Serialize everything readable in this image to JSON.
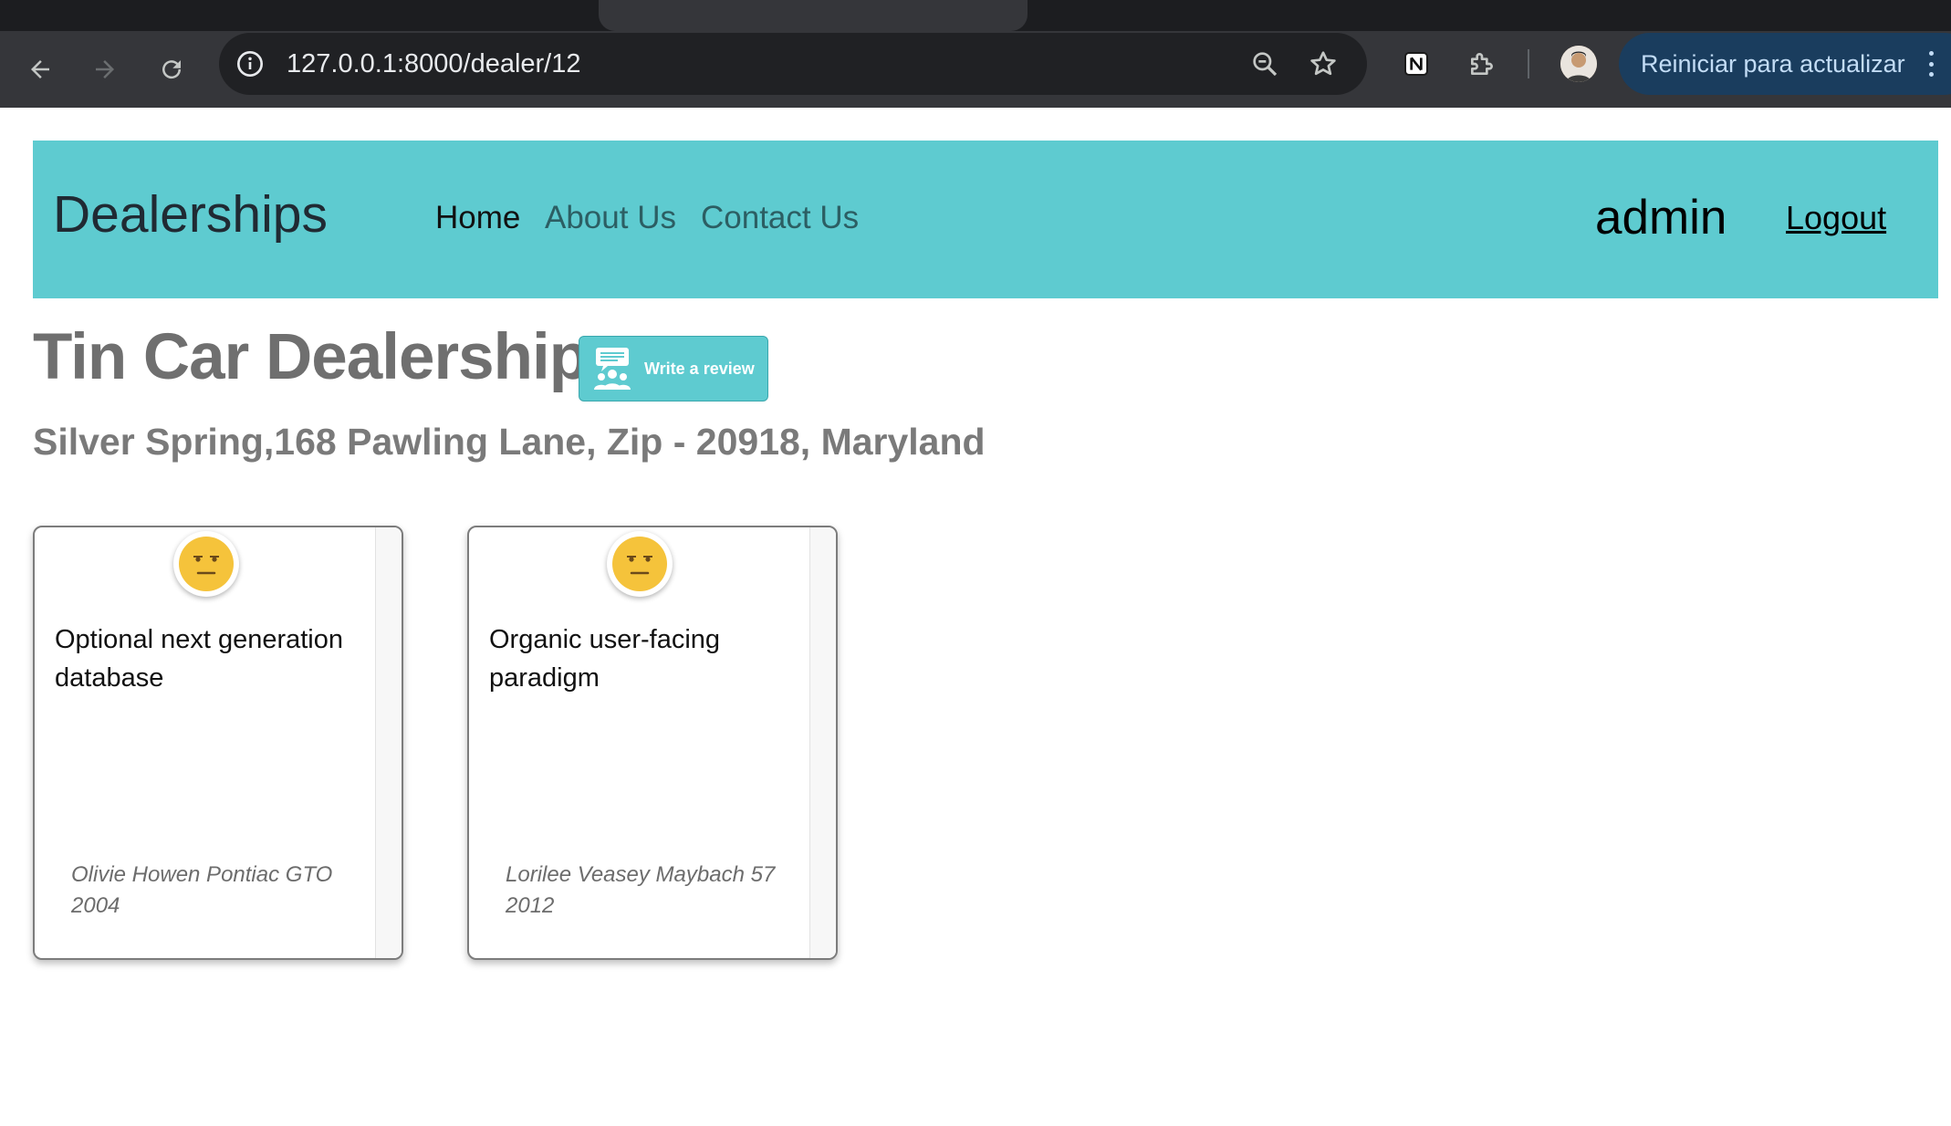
{
  "browser": {
    "url": "127.0.0.1:8000/dealer/12",
    "restart_label": "Reiniciar para actualizar"
  },
  "header": {
    "brand": "Dealerships",
    "nav": {
      "home": "Home",
      "about": "About Us",
      "contact": "Contact Us"
    },
    "username": "admin",
    "logout": "Logout",
    "color": "#5ecbd0"
  },
  "dealer": {
    "name": "Tin Car Dealership",
    "review_button": "Write a review",
    "address": "Silver Spring,168 Pawling Lane, Zip - 20918, Maryland"
  },
  "reviews": [
    {
      "text": "Optional next generation database",
      "car": "Olivie Howen Pontiac GTO 2004",
      "sentiment_icon": "neutral-face-icon"
    },
    {
      "text": "Organic user-facing paradigm",
      "car": "Lorilee Veasey Maybach 57 2012",
      "sentiment_icon": "neutral-face-icon"
    }
  ]
}
